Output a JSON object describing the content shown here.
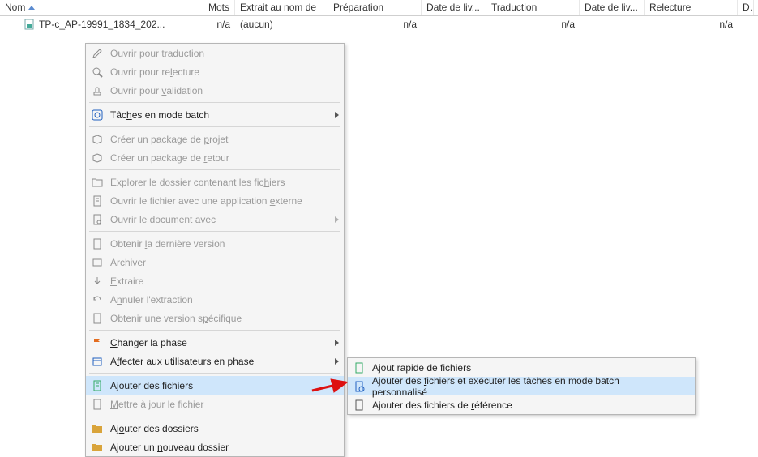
{
  "columns": {
    "name": "Nom",
    "words": "Mots",
    "issued_to": "Extrait au nom de",
    "preparation": "Préparation",
    "delivery1": "Date de liv...",
    "translation": "Traduction",
    "delivery2": "Date de liv...",
    "review": "Relecture",
    "d": "D"
  },
  "row": {
    "filename": "TP-c_AP-19991_1834_202...",
    "words": "n/a",
    "issued_to": "(aucun)",
    "preparation": "n/a",
    "delivery1": "",
    "translation": "n/a",
    "delivery2": "",
    "review": "n/a"
  },
  "menu": {
    "open_translation": "Ouvrir pour traduction",
    "open_review": "Ouvrir pour relecture",
    "open_validation": "Ouvrir pour validation",
    "batch_tasks": "Tâches en mode batch",
    "create_project_pkg": "Créer un package de projet",
    "create_return_pkg": "Créer un package de retour",
    "explore_folder": "Explorer le dossier contenant les fichiers",
    "open_external": "Ouvrir le fichier avec une application externe",
    "open_with": "Ouvrir le document avec",
    "get_latest": "Obtenir la dernière version",
    "archive": "Archiver",
    "extract": "Extraire",
    "cancel_extract": "Annuler l'extraction",
    "get_specific": "Obtenir une version spécifique",
    "change_phase": "Changer la phase",
    "assign_phase": "Affecter aux utilisateurs en phase",
    "add_files": "Ajouter des fichiers",
    "update_file": "Mettre à jour le fichier",
    "add_folders": "Ajouter des dossiers",
    "add_new_folder": "Ajouter un nouveau dossier"
  },
  "submenu": {
    "quick_add": "Ajout rapide de fichiers",
    "add_and_batch": "Ajouter des fichiers et exécuter les tâches en mode batch personnalisé",
    "add_reference": "Ajouter des fichiers de référence"
  }
}
